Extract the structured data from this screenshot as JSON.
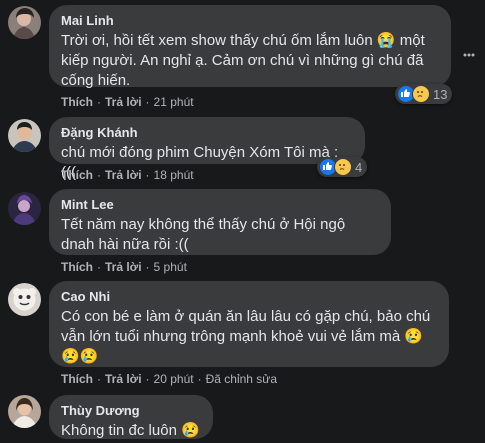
{
  "comments": [
    {
      "name": "Mai Linh",
      "text": "Trời ơi, hồi tết xem show thấy chú ốm lắm luôn 😭 một kiếp người. An nghỉ ạ. Cảm ơn chú vì những gì chú đã cống hiến.",
      "like": "Thích",
      "reply": "Trả lời",
      "time": "21 phút",
      "reaction_count": "13"
    },
    {
      "name": "Đặng Khánh",
      "text": "chú mới đóng phim Chuyện Xóm Tôi mà :(((",
      "like": "Thích",
      "reply": "Trả lời",
      "time": "18 phút",
      "reaction_count": "4"
    },
    {
      "name": "Mint Lee",
      "text": "Tết năm nay không thể thấy chú ở Hội ngộ dnah hài nữa rồi :((",
      "like": "Thích",
      "reply": "Trả lời",
      "time": "5 phút"
    },
    {
      "name": "Cao Nhi",
      "text": "Có con bé e làm ở quán ăn lâu lâu có gặp chú, bảo chú vẫn lớn tuổi nhưng trông mạnh khoẻ vui vẻ lắm mà 😢 😢😢",
      "like": "Thích",
      "reply": "Trả lời",
      "time": "20 phút",
      "edited": "Đã chỉnh sửa"
    },
    {
      "name": "Thùy Dương",
      "text": "Không tin đc luôn 😢"
    }
  ],
  "colors": {
    "background": "#18191a",
    "bubble": "#3a3b3c",
    "like_blue": "#1877f2",
    "emoji_yellow": "#f7c84b"
  },
  "icons": [
    "more-options-icon",
    "like-reaction-icon",
    "sad-reaction-icon"
  ]
}
